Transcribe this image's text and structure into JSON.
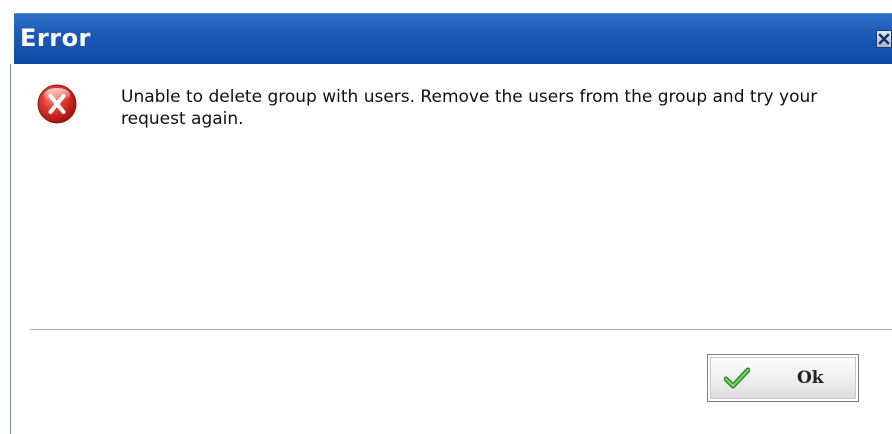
{
  "dialog": {
    "title": "Error",
    "message": "Unable to delete group with users. Remove the users from the group and try your request again.",
    "icons": {
      "close": "close-icon",
      "status": "error-icon",
      "confirm": "checkmark-icon"
    },
    "colors": {
      "titlebar": "#1b58b4",
      "title_text": "#ffffff",
      "error_icon": "#d42a2a",
      "checkmark": "#3aa33a"
    }
  },
  "buttons": {
    "ok_label": "Ok"
  }
}
